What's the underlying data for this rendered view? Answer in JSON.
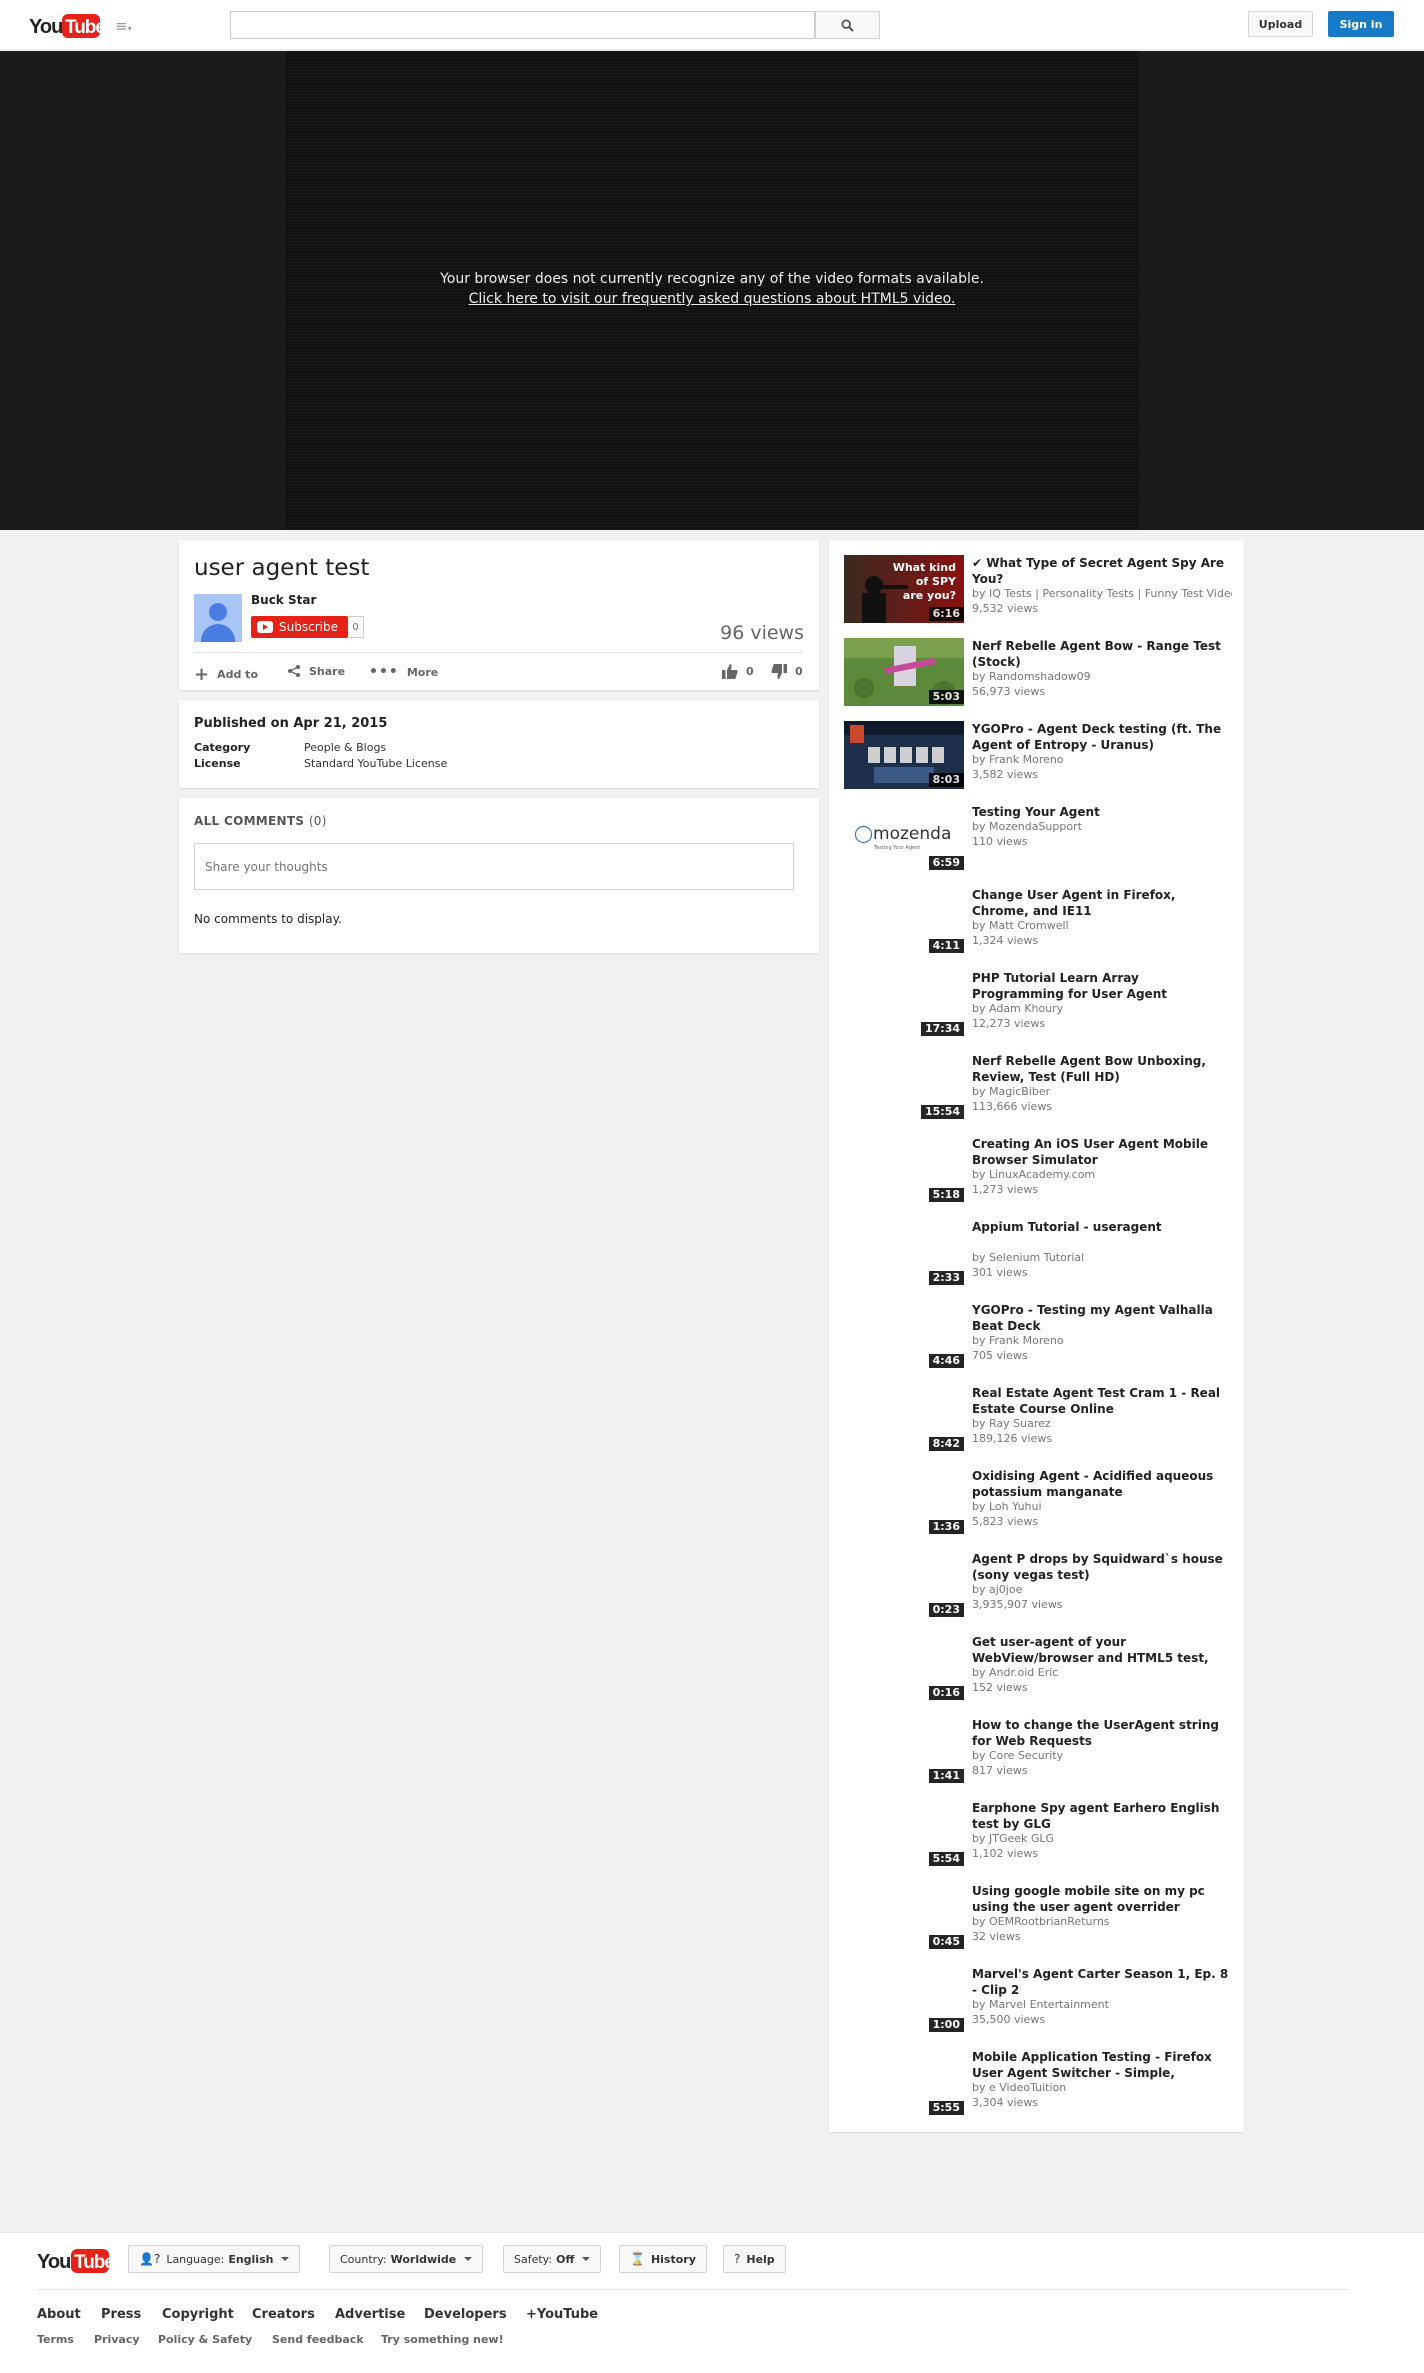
{
  "masthead": {
    "logo_text": "YouTube",
    "search_placeholder": "",
    "upload_label": "Upload",
    "signin_label": "Sign in"
  },
  "player": {
    "message": "Your browser does not currently recognize any of the video formats available.",
    "help_link": "Click here to visit our frequently asked questions about HTML5 video."
  },
  "video": {
    "title": "user agent test",
    "channel": "Buck Star",
    "subscribe_label": "Subscribe",
    "subscriber_count": "0",
    "views": "96 views",
    "actions": {
      "add_to": "Add to",
      "share": "Share",
      "more": "More",
      "likes": "0",
      "dislikes": "0"
    }
  },
  "description": {
    "published": "Published on Apr 21, 2015",
    "category_label": "Category",
    "category_value": "People & Blogs",
    "license_label": "License",
    "license_value": "Standard YouTube License"
  },
  "comments": {
    "header": "ALL COMMENTS",
    "count": "(0)",
    "placeholder": "Share your thoughts",
    "empty_text": "No comments to display."
  },
  "recommendations": [
    {
      "title": "✔ What Type of Secret Agent Spy Are You?",
      "by": "by IQ Tests | Personality Tests | Funny Test Videos",
      "views": "9,532 views",
      "duration": "6:16",
      "thumb": "spy"
    },
    {
      "title": "Nerf Rebelle Agent Bow - Range Test (Stock)",
      "by": "by Randomshadow09",
      "views": "56,973 views",
      "duration": "5:03",
      "thumb": "grass"
    },
    {
      "title": "YGOPro - Agent Deck testing (ft. The Agent of Entropy - Uranus)",
      "by": "by Frank Moreno",
      "views": "3,582 views",
      "duration": "8:03",
      "thumb": "cards"
    },
    {
      "title": "Testing Your Agent",
      "by": "by MozendaSupport",
      "views": "110 views",
      "duration": "6:59",
      "thumb": "mozenda",
      "thumb_text": "mozenda",
      "thumb_sub": "Testing Your Agent"
    },
    {
      "title": "Change User Agent in Firefox, Chrome, and IE11",
      "by": "by Matt Cromwell",
      "views": "1,324 views",
      "duration": "4:11",
      "thumb": "blank"
    },
    {
      "title": "PHP Tutorial Learn Array Programming for User Agent",
      "by": "by Adam Khoury",
      "views": "12,273 views",
      "duration": "17:34",
      "thumb": "blank"
    },
    {
      "title": "Nerf Rebelle Agent Bow Unboxing, Review, Test (Full HD)",
      "by": "by MagicBiber",
      "views": "113,666 views",
      "duration": "15:54",
      "thumb": "blank"
    },
    {
      "title": "Creating An iOS User Agent Mobile Browser Simulator",
      "by": "by LinuxAcademy.com",
      "views": "1,273 views",
      "duration": "5:18",
      "thumb": "blank"
    },
    {
      "title": "Appium Tutorial - useragent",
      "by": "by Selenium Tutorial",
      "views": "301 views",
      "duration": "2:33",
      "thumb": "blank"
    },
    {
      "title": "YGOPro - Testing my Agent Valhalla Beat Deck",
      "by": "by Frank Moreno",
      "views": "705 views",
      "duration": "4:46",
      "thumb": "blank"
    },
    {
      "title": "Real Estate Agent Test Cram 1 - Real Estate Course Online",
      "by": "by Ray Suarez",
      "views": "189,126 views",
      "duration": "8:42",
      "thumb": "blank"
    },
    {
      "title": "Oxidising Agent - Acidified aqueous potassium manganate",
      "by": "by Loh Yuhui",
      "views": "5,823 views",
      "duration": "1:36",
      "thumb": "blank"
    },
    {
      "title": "Agent P drops by Squidward`s house (sony vegas test)",
      "by": "by aj0joe",
      "views": "3,935,907 views",
      "duration": "0:23",
      "thumb": "blank"
    },
    {
      "title": "Get user-agent of your WebView/browser and HTML5 test,",
      "by": "by Andr.oid Eric",
      "views": "152 views",
      "duration": "0:16",
      "thumb": "blank"
    },
    {
      "title": "How to change the UserAgent string for Web Requests",
      "by": "by Core Security",
      "views": "817 views",
      "duration": "1:41",
      "thumb": "blank"
    },
    {
      "title": "Earphone Spy agent Earhero English test by GLG",
      "by": "by JTGeek GLG",
      "views": "1,102 views",
      "duration": "5:54",
      "thumb": "blank"
    },
    {
      "title": "Using google mobile site on my pc using the user agent overrider",
      "by": "by OEMRootbrianReturns",
      "views": "32 views",
      "duration": "0:45",
      "thumb": "blank"
    },
    {
      "title": "Marvel's Agent Carter Season 1, Ep. 8 - Clip 2",
      "by": "by Marvel Entertainment",
      "views": "35,500 views",
      "duration": "1:00",
      "thumb": "blank"
    },
    {
      "title": "Mobile Application Testing - Firefox User Agent Switcher - Simple,",
      "by": "by e VideoTuition",
      "views": "3,304 views",
      "duration": "5:55",
      "thumb": "blank"
    }
  ],
  "footer": {
    "logo_text": "YouTube",
    "language_label": "Language:",
    "language_value": "English",
    "country_label": "Country:",
    "country_value": "Worldwide",
    "safety_label": "Safety:",
    "safety_value": "Off",
    "history_label": "History",
    "help_label": "Help",
    "links": [
      "About",
      "Press",
      "Copyright",
      "Creators",
      "Advertise",
      "Developers",
      "+YouTube"
    ],
    "sublinks": [
      "Terms",
      "Privacy",
      "Policy & Safety",
      "Send feedback",
      "Try something new!"
    ]
  },
  "colors": {
    "brand_red": "#e62117",
    "signin_blue": "#167ac6"
  }
}
